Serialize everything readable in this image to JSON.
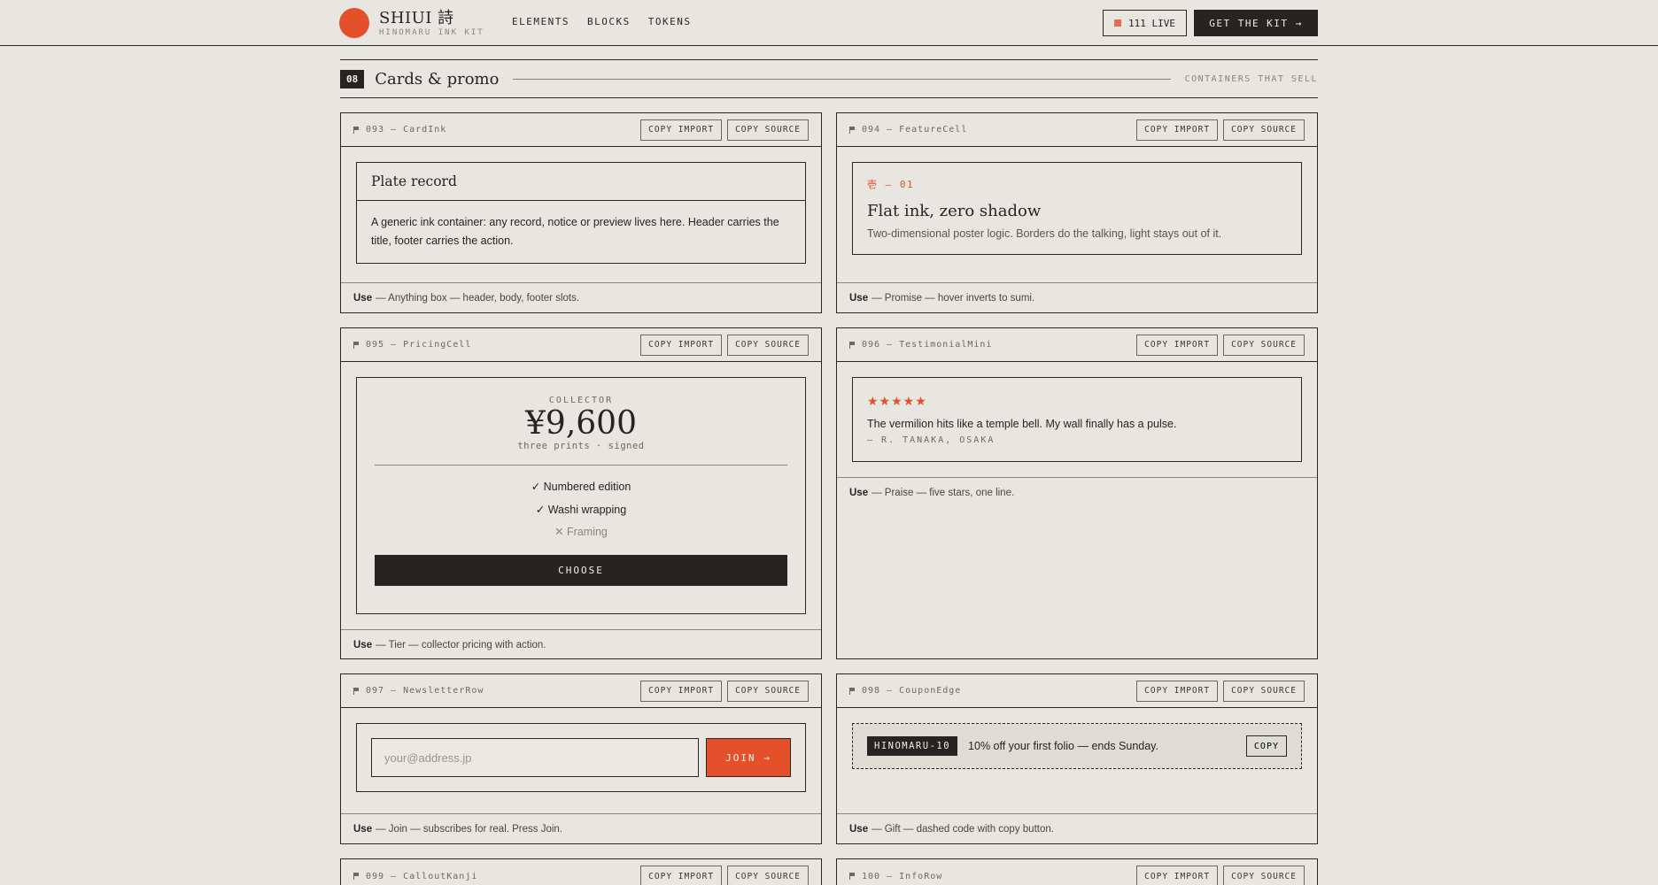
{
  "header": {
    "brand_name": "SHIUI 詩",
    "brand_sub": "HINOMARU INK KIT",
    "nav": [
      "ELEMENTS",
      "BLOCKS",
      "TOKENS"
    ],
    "live_label": "111 LIVE",
    "cta_label": "GET THE KIT →"
  },
  "section": {
    "number": "08",
    "title": "Cards & promo",
    "tag": "CONTAINERS THAT SELL"
  },
  "buttons": {
    "copy_import": "COPY IMPORT",
    "copy_source": "COPY SOURCE"
  },
  "cards": {
    "card_ink": {
      "id": "093 — CardInk",
      "title": "Plate record",
      "body": "A generic ink container: any record, notice or preview lives here. Header carries the title, footer carries the action.",
      "use_label": "Use",
      "use_text": "— Anything box — header, body, footer slots."
    },
    "feature": {
      "id": "094 — FeatureCell",
      "kicker": "壱 — 01",
      "title": "Flat ink, zero shadow",
      "text": "Two-dimensional poster logic. Borders do the talking, light stays out of it.",
      "use_label": "Use",
      "use_text": "— Promise — hover inverts to sumi."
    },
    "pricing": {
      "id": "095 — PricingCell",
      "tier": "COLLECTOR",
      "price": "¥9,600",
      "price_sub": "three prints · signed",
      "features": [
        "✓ Numbered edition",
        "✓ Washi wrapping",
        "✕ Framing"
      ],
      "button": "CHOOSE",
      "use_label": "Use",
      "use_text": "— Tier — collector pricing with action."
    },
    "testimonial": {
      "id": "096 — TestimonialMini",
      "stars": "★★★★★",
      "quote": "The vermilion hits like a temple bell. My wall finally has a pulse.",
      "author": "— R. TANAKA, OSAKA",
      "use_label": "Use",
      "use_text": "— Praise — five stars, one line."
    },
    "newsletter": {
      "id": "097 — NewsletterRow",
      "placeholder": "your@address.jp",
      "button": "JOIN →",
      "use_label": "Use",
      "use_text": "— Join — subscribes for real. Press Join."
    },
    "coupon": {
      "id": "098 — CouponEdge",
      "code": "HINOMARU-10",
      "text": "10% off your first folio — ends Sunday.",
      "button": "COPY",
      "use_label": "Use",
      "use_text": "— Gift — dashed code with copy button."
    },
    "callout": {
      "id": "099 — CalloutKanji"
    },
    "info": {
      "id": "100 — InfoRow"
    }
  },
  "colors": {
    "paper": "#e8e6e1",
    "sumi": "#262422",
    "vermilion": "#e4502a"
  }
}
